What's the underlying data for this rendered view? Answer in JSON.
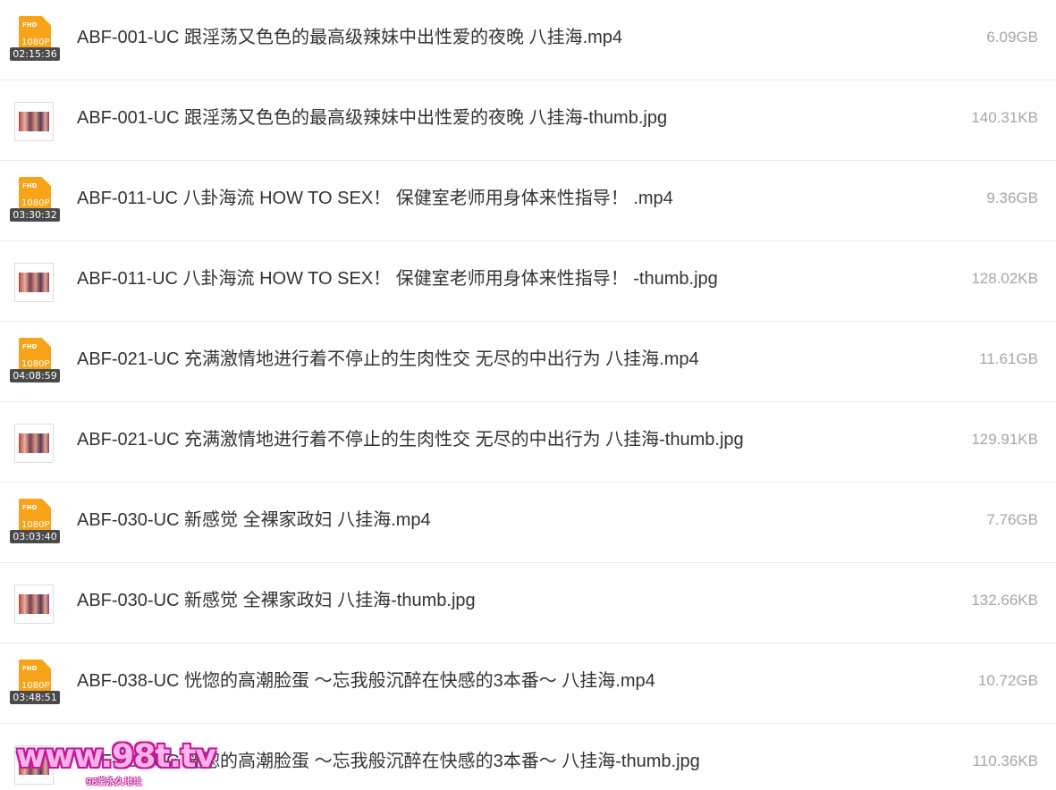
{
  "files": [
    {
      "name": "ABF-001-UC 跟淫荡又色色的最高级辣妹中出性爱的夜晚 八挂海.mp4",
      "size": "6.09GB",
      "type": "video",
      "badge": "FHD",
      "resolution": "1080P",
      "duration": "02:15:36"
    },
    {
      "name": "ABF-001-UC 跟淫荡又色色的最高级辣妹中出性爱的夜晚 八挂海-thumb.jpg",
      "size": "140.31KB",
      "type": "image"
    },
    {
      "name": "ABF-011-UC 八卦海流 HOW TO SEX！ 保健室老师用身体来性指导！ .mp4",
      "size": "9.36GB",
      "type": "video",
      "badge": "FHD",
      "resolution": "1080P",
      "duration": "03:30:32"
    },
    {
      "name": "ABF-011-UC 八卦海流 HOW TO SEX！ 保健室老师用身体来性指导！ -thumb.jpg",
      "size": "128.02KB",
      "type": "image"
    },
    {
      "name": "ABF-021-UC 充满激情地进行着不停止的生肉性交 无尽的中出行为 八挂海.mp4",
      "size": "11.61GB",
      "type": "video",
      "badge": "FHD",
      "resolution": "1080P",
      "duration": "04:08:59"
    },
    {
      "name": "ABF-021-UC 充满激情地进行着不停止的生肉性交 无尽的中出行为 八挂海-thumb.jpg",
      "size": "129.91KB",
      "type": "image"
    },
    {
      "name": "ABF-030-UC 新感觉 全裸家政妇 八挂海.mp4",
      "size": "7.76GB",
      "type": "video",
      "badge": "FHD",
      "resolution": "1080P",
      "duration": "03:03:40"
    },
    {
      "name": "ABF-030-UC 新感觉 全裸家政妇 八挂海-thumb.jpg",
      "size": "132.66KB",
      "type": "image"
    },
    {
      "name": "ABF-038-UC 恍惚的高潮脸蛋 ～忘我般沉醉在快感的3本番～ 八挂海.mp4",
      "size": "10.72GB",
      "type": "video",
      "badge": "FHD",
      "resolution": "1080P",
      "duration": "03:48:51"
    },
    {
      "name": "ABF-038-UC 恍惚的高潮脸蛋 ～忘我般沉醉在快感的3本番～ 八挂海-thumb.jpg",
      "size": "110.36KB",
      "type": "image"
    }
  ],
  "watermark": {
    "text": "www.98t.tv",
    "subtext": "98堂永久地址"
  },
  "colors": {
    "video_icon": "#f7a418",
    "file_name": "#333333",
    "file_size": "#a6a6a6",
    "divider": "#ebebeb"
  }
}
